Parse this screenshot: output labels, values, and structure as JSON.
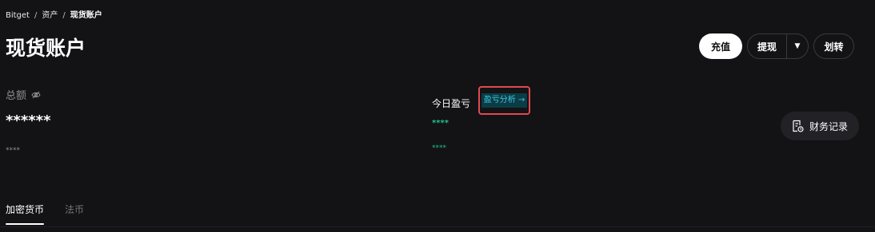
{
  "breadcrumb": {
    "items": [
      "Bitget",
      "资产",
      "现货账户"
    ],
    "separator": "/"
  },
  "header": {
    "title": "现货账户",
    "actions": {
      "deposit": "充值",
      "withdraw": "提现",
      "transfer": "划转"
    }
  },
  "total": {
    "label": "总额",
    "value": "******",
    "sub": "****"
  },
  "pnl": {
    "label": "今日盈亏",
    "analysis_link": "盈亏分析 →",
    "value": "****",
    "sub": "****"
  },
  "records": {
    "label": "财务记录"
  },
  "tabs": [
    {
      "label": "加密货币",
      "active": true
    },
    {
      "label": "法币",
      "active": false
    }
  ],
  "colors": {
    "background": "#131316",
    "positive": "#21c288",
    "link": "#3ec8e0",
    "highlight_border": "#e04a4d"
  }
}
